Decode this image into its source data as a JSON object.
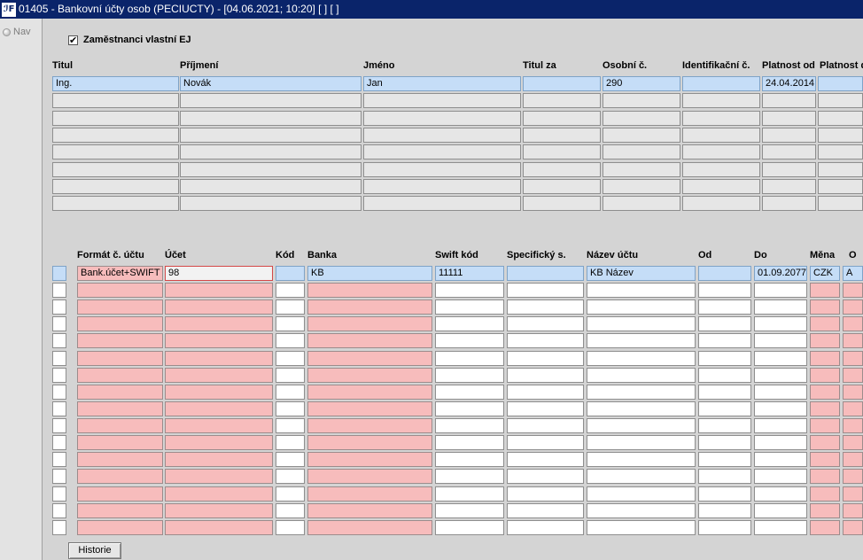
{
  "window": {
    "title": "01405 - Bankovní účty osob (PECIUCTY) - [04.06.2021; 10:20]  [ ]  [ ]",
    "app_icon_text": "ℐF"
  },
  "nav": {
    "label": "Nav"
  },
  "filter": {
    "checkbox_label": "Zaměstnanci vlastní EJ",
    "checked": true
  },
  "persons": {
    "headers": [
      "Titul",
      "Příjmení",
      "Jméno",
      "Titul za",
      "Osobní č.",
      "Identifikační č.",
      "Platnost od",
      "Platnost do"
    ],
    "rows": [
      [
        "Ing.",
        "Novák",
        "Jan",
        "",
        "290",
        "",
        "24.04.2014",
        ""
      ],
      [
        "",
        "",
        "",
        "",
        "",
        "",
        "",
        ""
      ],
      [
        "",
        "",
        "",
        "",
        "",
        "",
        "",
        ""
      ],
      [
        "",
        "",
        "",
        "",
        "",
        "",
        "",
        ""
      ],
      [
        "",
        "",
        "",
        "",
        "",
        "",
        "",
        ""
      ],
      [
        "",
        "",
        "",
        "",
        "",
        "",
        "",
        ""
      ],
      [
        "",
        "",
        "",
        "",
        "",
        "",
        "",
        ""
      ],
      [
        "",
        "",
        "",
        "",
        "",
        "",
        "",
        ""
      ]
    ]
  },
  "accounts": {
    "headers": [
      "Formát č. účtu",
      "Účet",
      "Kód",
      "Banka",
      "Swift kód",
      "Specifický s.",
      "Název účtu",
      "Od",
      "Do",
      "Měna",
      "O"
    ],
    "rows": [
      [
        "Bank.účet+SWIFT",
        "98",
        "",
        "KB",
        "11111",
        "",
        "KB Název",
        "",
        "01.09.2077",
        "CZK",
        "A"
      ],
      [
        "",
        "",
        "",
        "",
        "",
        "",
        "",
        "",
        "",
        "",
        ""
      ],
      [
        "",
        "",
        "",
        "",
        "",
        "",
        "",
        "",
        "",
        "",
        ""
      ],
      [
        "",
        "",
        "",
        "",
        "",
        "",
        "",
        "",
        "",
        "",
        ""
      ],
      [
        "",
        "",
        "",
        "",
        "",
        "",
        "",
        "",
        "",
        "",
        ""
      ],
      [
        "",
        "",
        "",
        "",
        "",
        "",
        "",
        "",
        "",
        "",
        ""
      ],
      [
        "",
        "",
        "",
        "",
        "",
        "",
        "",
        "",
        "",
        "",
        ""
      ],
      [
        "",
        "",
        "",
        "",
        "",
        "",
        "",
        "",
        "",
        "",
        ""
      ],
      [
        "",
        "",
        "",
        "",
        "",
        "",
        "",
        "",
        "",
        "",
        ""
      ],
      [
        "",
        "",
        "",
        "",
        "",
        "",
        "",
        "",
        "",
        "",
        ""
      ],
      [
        "",
        "",
        "",
        "",
        "",
        "",
        "",
        "",
        "",
        "",
        ""
      ],
      [
        "",
        "",
        "",
        "",
        "",
        "",
        "",
        "",
        "",
        "",
        ""
      ],
      [
        "",
        "",
        "",
        "",
        "",
        "",
        "",
        "",
        "",
        "",
        ""
      ],
      [
        "",
        "",
        "",
        "",
        "",
        "",
        "",
        "",
        "",
        "",
        ""
      ],
      [
        "",
        "",
        "",
        "",
        "",
        "",
        "",
        "",
        "",
        "",
        ""
      ],
      [
        "",
        "",
        "",
        "",
        "",
        "",
        "",
        "",
        "",
        "",
        ""
      ]
    ]
  },
  "buttons": {
    "history_label": "Historie"
  },
  "colors": {
    "titlebar": "#0a246a",
    "selected_row": "#c5ddf7",
    "required_field": "#f7bcbc",
    "active_field_border": "#d44848"
  }
}
